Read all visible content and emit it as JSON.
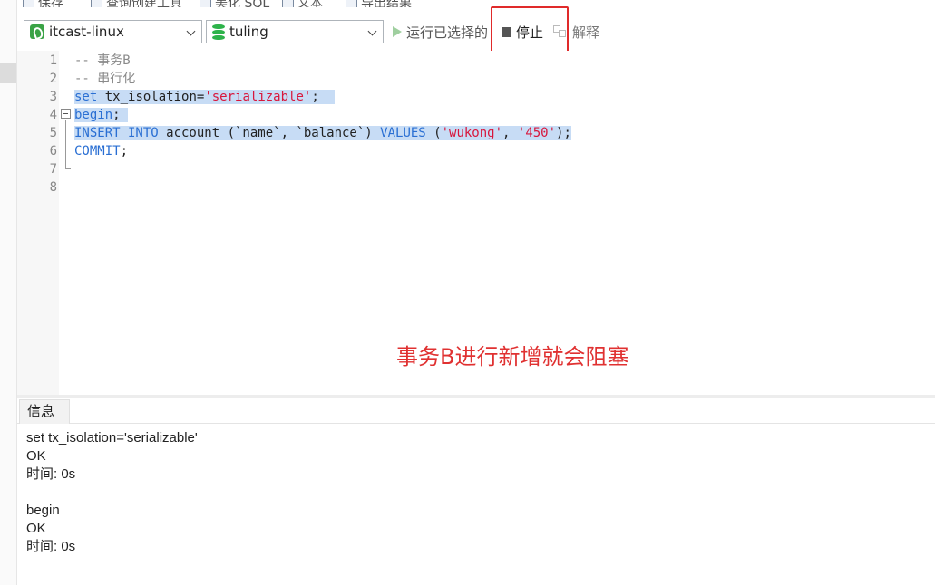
{
  "top_toolbar": {
    "save": "保存",
    "query_builder": "查询创建工具",
    "beautify": "美化 SQL",
    "text": "文本",
    "export": "导出结果"
  },
  "toolbar": {
    "connection": "itcast-linux",
    "database": "tuling",
    "run_selected": "运行已选择的",
    "stop": "停止",
    "explain": "解释"
  },
  "editor": {
    "line_numbers": [
      "1",
      "2",
      "3",
      "4",
      "5",
      "6",
      "7",
      "8"
    ],
    "lines": {
      "l1": "-- 事务B",
      "l2": "-- 串行化",
      "l3": {
        "a": "set",
        "b": " tx_isolation=",
        "c": "'serializable'",
        "d": ";"
      },
      "l4": {
        "a": "begin",
        "b": ";"
      },
      "l5": {
        "a": "INSERT INTO",
        "b": " account (`name`, `balance`) ",
        "c": "VALUES",
        "d": " (",
        "e": "'wukong'",
        "f": ", ",
        "g": "'450'",
        "h": ");"
      },
      "l6": {
        "a": "COMMIT",
        "b": ";"
      }
    }
  },
  "annotation": "事务B进行新增就会阻塞",
  "result_tab": "信息",
  "messages": [
    "set tx_isolation='serializable'",
    "OK",
    "时间: 0s",
    "",
    "begin",
    "OK",
    "时间: 0s"
  ],
  "colors": {
    "keyword": "#2a6fd3",
    "string": "#d8163b",
    "comment": "#8a8a8a",
    "selection": "#c7dcf5",
    "annotation": "#e03131"
  }
}
